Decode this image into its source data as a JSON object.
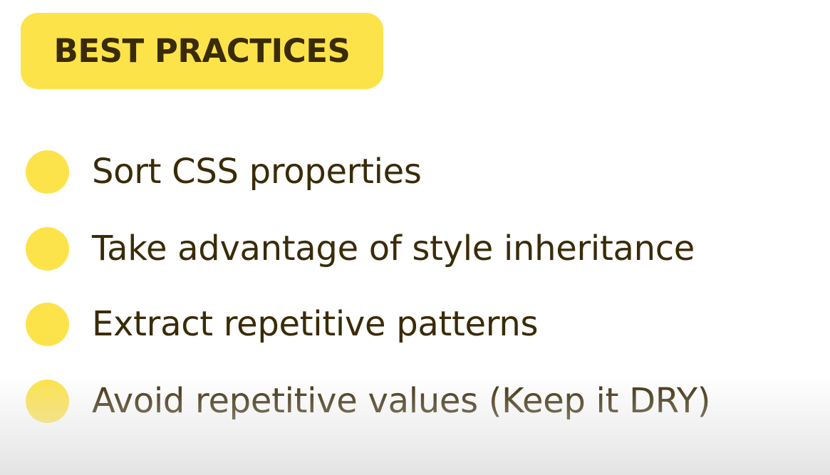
{
  "colors": {
    "accent": "#fde34a",
    "text": "#3a2b08",
    "background": "#ffffff"
  },
  "header": {
    "badge_label": "BEST PRACTICES"
  },
  "list": {
    "items": [
      {
        "label": "Sort CSS properties"
      },
      {
        "label": "Take advantage of style inheritance"
      },
      {
        "label": "Extract repetitive patterns"
      },
      {
        "label": "Avoid repetitive values (Keep it DRY)"
      }
    ]
  }
}
